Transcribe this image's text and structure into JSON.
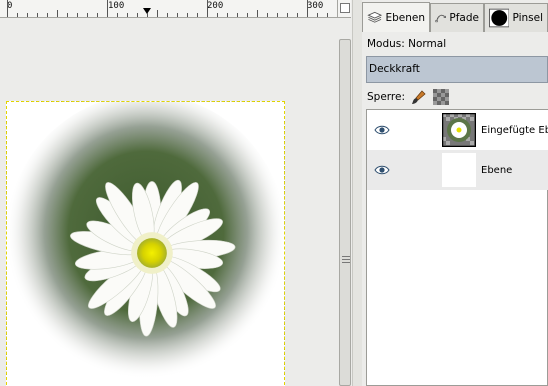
{
  "ruler": {
    "labels": [
      "0",
      "100",
      "200",
      "300"
    ]
  },
  "dock": {
    "tabs": [
      {
        "label": "Ebenen",
        "icon": "layers-icon",
        "active": true
      },
      {
        "label": "Pfade",
        "icon": "paths-icon",
        "active": false
      },
      {
        "label": "Pinsel",
        "icon": "brush-tip-icon",
        "active": false
      }
    ],
    "mode_label": "Modus: Normal",
    "opacity_label": "Deckkraft",
    "lock_label": "Sperre:",
    "lock_icons": [
      "paintbrush-lock-icon",
      "alpha-lock-icon"
    ]
  },
  "layers": [
    {
      "name": "Eingefügte Ebene",
      "visible": true,
      "thumb": "flower-thumbnail"
    },
    {
      "name": "Ebene",
      "visible": true,
      "thumb": "white-thumbnail"
    }
  ],
  "colors": {
    "selection_highlight": "#bcc6d2",
    "selection_marching_ants": "#e2d500"
  }
}
